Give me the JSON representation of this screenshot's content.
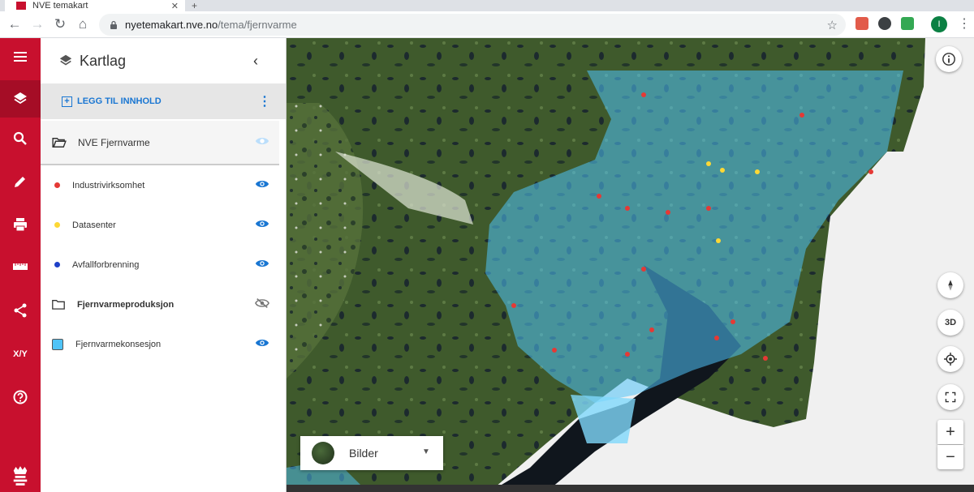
{
  "browser": {
    "tab_title": "NVE temakart",
    "url_host": "nyetemakart.nve.no",
    "url_path": "/tema/fjernvarme",
    "profile_initial": "I"
  },
  "panel": {
    "title": "Kartlag",
    "add_content": "LEGG TIL INNHOLD",
    "group": {
      "label": "NVE Fjernvarme",
      "visible": false
    },
    "layers": [
      {
        "label": "Industrivirksomhet",
        "color": "#e53935",
        "visible": true,
        "bold": false
      },
      {
        "label": "Datasenter",
        "color": "#fdd835",
        "visible": true,
        "bold": false
      },
      {
        "label": "Avfallforbrenning",
        "color": "#1e40c8",
        "visible": true,
        "bold": false
      },
      {
        "label": "Fjernvarmeproduksjon",
        "color": "",
        "visible": false,
        "bold": true
      },
      {
        "label": "Fjernvarmekonsesjon",
        "color": "#4fc3f7",
        "visible": true,
        "bold": false
      }
    ]
  },
  "rail": {
    "xy_label": "X/Y"
  },
  "map": {
    "basemap_label": "Bilder",
    "btn_3d": "3D",
    "zoom_in": "+",
    "zoom_out": "−"
  },
  "colors": {
    "accent": "#c8102e",
    "link": "#1976d2",
    "concession_fill": "#4fc3f7"
  }
}
